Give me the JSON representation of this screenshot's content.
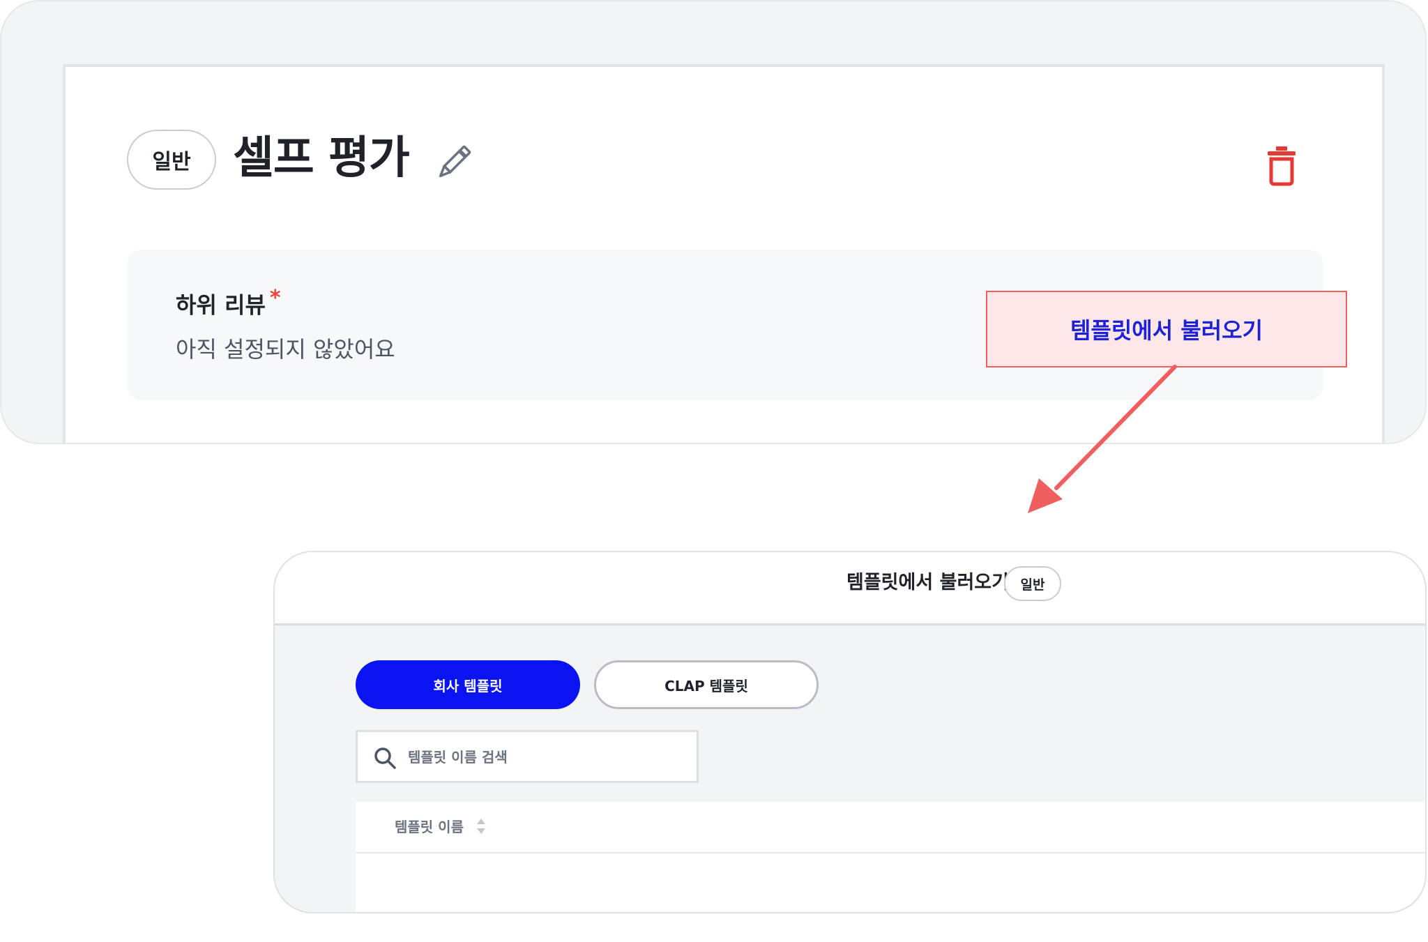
{
  "top": {
    "type_badge": "일반",
    "title": "셀프 평가",
    "review": {
      "label": "하위 리뷰",
      "required_mark": "*",
      "value": "아직 설정되지 않았어요"
    },
    "load_template_label": "템플릿에서 불러오기"
  },
  "modal": {
    "title": "템플릿에서 불러오기",
    "type_badge": "일반",
    "tabs": [
      {
        "label": "회사 템플릿",
        "active": true
      },
      {
        "label": "CLAP 템플릿",
        "active": false
      }
    ],
    "search": {
      "placeholder": "템플릿 이름 검색",
      "value": ""
    },
    "table": {
      "columns": [
        {
          "label": "템플릿 이름"
        }
      ]
    }
  },
  "colors": {
    "primary": "#0a14f0",
    "danger": "#e53935",
    "highlight_fill": "#fde7e9",
    "highlight_border": "#f0605f",
    "arrow": "#f05f5f",
    "highlight_text": "#1d22d6"
  },
  "icons": {
    "edit": "pencil-icon",
    "delete": "trash-icon",
    "search": "search-icon",
    "sort": "sort-icon"
  }
}
